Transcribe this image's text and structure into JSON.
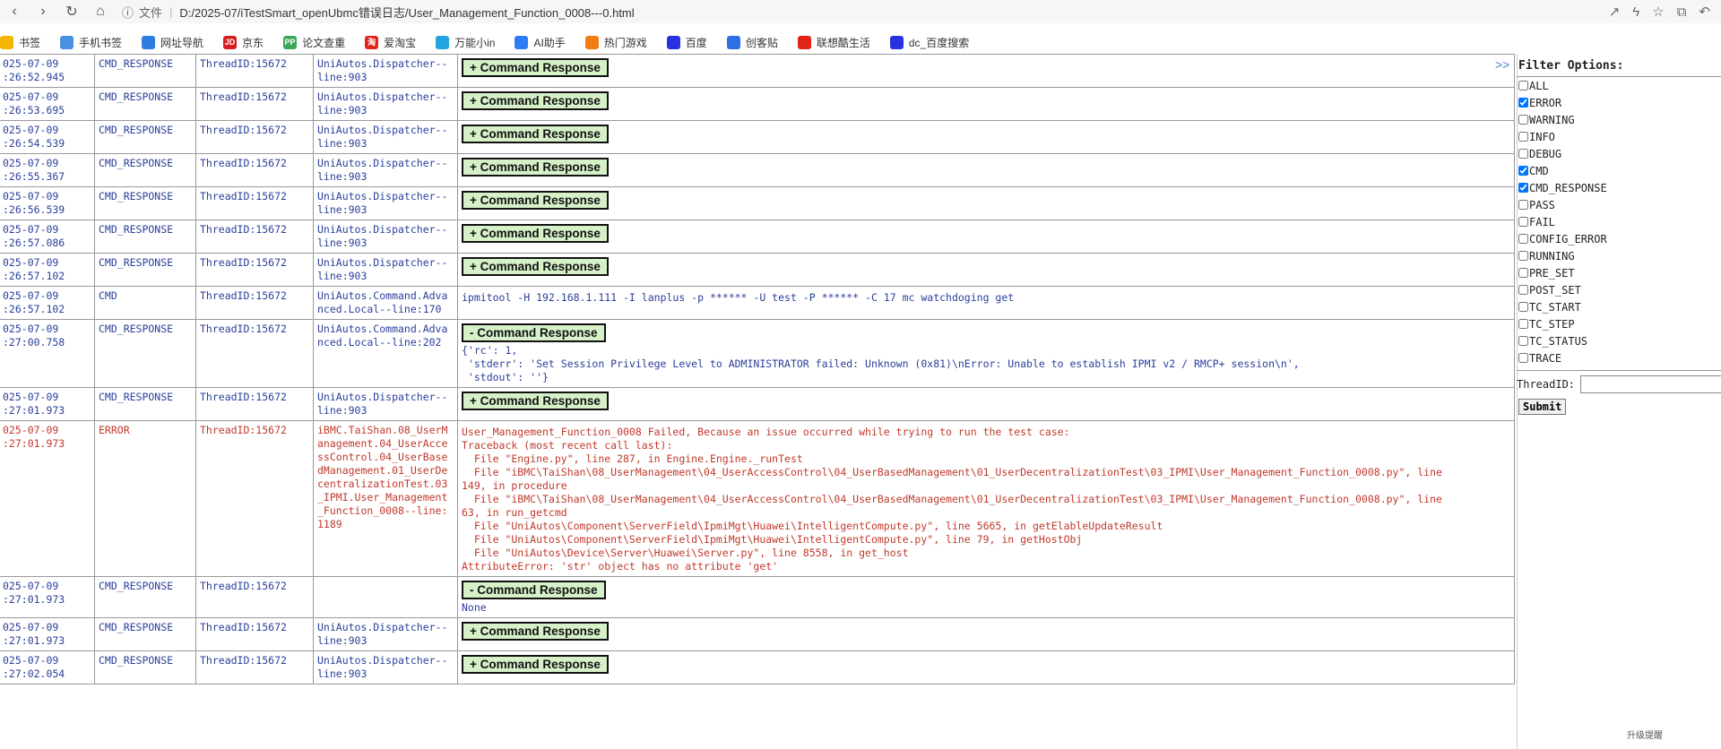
{
  "browser": {
    "file_label": "文件",
    "address": "D:/2025-07/iTestSmart_openUbmc错误日志/User_Management_Function_0008---0.html"
  },
  "bookmarks": [
    {
      "label": "书签",
      "icon": "star-icon",
      "color": "#f5b400"
    },
    {
      "label": "手机书签",
      "icon": "folder-icon",
      "color": "#4a90e2"
    },
    {
      "label": "网址导航",
      "icon": "nav-icon",
      "color": "#2e7de1"
    },
    {
      "label": "京东",
      "icon": "jd-icon",
      "color": "#d71c1e",
      "glyph": "JD"
    },
    {
      "label": "论文查重",
      "icon": "pp-icon",
      "color": "#3aa757",
      "glyph": "PP"
    },
    {
      "label": "爱淘宝",
      "icon": "taobao-icon",
      "color": "#e1251b",
      "glyph": "淘"
    },
    {
      "label": "万能小in",
      "icon": "in-icon",
      "color": "#21a4e0"
    },
    {
      "label": "AI助手",
      "icon": "ai-icon",
      "color": "#2f7df6"
    },
    {
      "label": "热门游戏",
      "icon": "game-icon",
      "color": "#f27b13"
    },
    {
      "label": "百度",
      "icon": "baidu-icon",
      "color": "#2932e1"
    },
    {
      "label": "创客贴",
      "icon": "ckt-icon",
      "color": "#2f6fe4"
    },
    {
      "label": "联想酷生活",
      "icon": "lenovo-icon",
      "color": "#e2231a"
    },
    {
      "label": "dc_百度搜索",
      "icon": "baidu-icon",
      "color": "#2932e1"
    }
  ],
  "log": {
    "response_plus": "+ Command Response",
    "response_minus": "- Command Response",
    "rows": [
      {
        "time": "025-07-09\n:26:52.945",
        "level": "CMD_RESPONSE",
        "thread": "ThreadID:15672",
        "source": "UniAutos.Dispatcher--line:903",
        "kind": "plus"
      },
      {
        "time": "025-07-09\n:26:53.695",
        "level": "CMD_RESPONSE",
        "thread": "ThreadID:15672",
        "source": "UniAutos.Dispatcher--line:903",
        "kind": "plus"
      },
      {
        "time": "025-07-09\n:26:54.539",
        "level": "CMD_RESPONSE",
        "thread": "ThreadID:15672",
        "source": "UniAutos.Dispatcher--line:903",
        "kind": "plus"
      },
      {
        "time": "025-07-09\n:26:55.367",
        "level": "CMD_RESPONSE",
        "thread": "ThreadID:15672",
        "source": "UniAutos.Dispatcher--line:903",
        "kind": "plus"
      },
      {
        "time": "025-07-09\n:26:56.539",
        "level": "CMD_RESPONSE",
        "thread": "ThreadID:15672",
        "source": "UniAutos.Dispatcher--line:903",
        "kind": "plus"
      },
      {
        "time": "025-07-09\n:26:57.086",
        "level": "CMD_RESPONSE",
        "thread": "ThreadID:15672",
        "source": "UniAutos.Dispatcher--line:903",
        "kind": "plus"
      },
      {
        "time": "025-07-09\n:26:57.102",
        "level": "CMD_RESPONSE",
        "thread": "ThreadID:15672",
        "source": "UniAutos.Dispatcher--line:903",
        "kind": "plus"
      },
      {
        "time": "025-07-09\n:26:57.102",
        "level": "CMD",
        "thread": "ThreadID:15672",
        "source": "UniAutos.Command.Advanced.Local--line:170",
        "kind": "text",
        "message": "ipmitool -H 192.168.1.111 -I lanplus -p ****** -U test -P ****** -C 17 mc watchdoging get"
      },
      {
        "time": "025-07-09\n:27:00.758",
        "level": "CMD_RESPONSE",
        "thread": "ThreadID:15672",
        "source": "UniAutos.Command.Advanced.Local--line:202",
        "kind": "minus",
        "detail": "{'rc': 1,\n 'stderr': 'Set Session Privilege Level to ADMINISTRATOR failed: Unknown (0x81)\\nError: Unable to establish IPMI v2 / RMCP+ session\\n',\n 'stdout': ''}"
      },
      {
        "time": "025-07-09\n:27:01.973",
        "level": "CMD_RESPONSE",
        "thread": "ThreadID:15672",
        "source": "UniAutos.Dispatcher--line:903",
        "kind": "plus"
      },
      {
        "time": "025-07-09\n:27:01.973",
        "level": "ERROR",
        "thread": "ThreadID:15672",
        "source": "iBMC.TaiShan.08_UserManagement.04_UserAccessControl.04_UserBasedManagement.01_UserDecentralizationTest.03_IPMI.User_Management_Function_0008--line:1189",
        "kind": "text",
        "message": "User_Management_Function_0008 Failed, Because an issue occurred while trying to run the test case:\nTraceback (most recent call last):\n  File \"Engine.py\", line 287, in Engine.Engine._runTest\n  File \"iBMC\\TaiShan\\08_UserManagement\\04_UserAccessControl\\04_UserBasedManagement\\01_UserDecentralizationTest\\03_IPMI\\User_Management_Function_0008.py\", line\n149, in procedure\n  File \"iBMC\\TaiShan\\08_UserManagement\\04_UserAccessControl\\04_UserBasedManagement\\01_UserDecentralizationTest\\03_IPMI\\User_Management_Function_0008.py\", line\n63, in run_getcmd\n  File \"UniAutos\\Component\\ServerField\\IpmiMgt\\Huawei\\IntelligentCompute.py\", line 5665, in getElableUpdateResult\n  File \"UniAutos\\Component\\ServerField\\IpmiMgt\\Huawei\\IntelligentCompute.py\", line 79, in getHostObj\n  File \"UniAutos\\Device\\Server\\Huawei\\Server.py\", line 8558, in get_host\nAttributeError: 'str' object has no attribute 'get'"
      },
      {
        "time": "025-07-09\n:27:01.973",
        "level": "CMD_RESPONSE",
        "thread": "ThreadID:15672",
        "source": "",
        "kind": "minus",
        "detail": "None"
      },
      {
        "time": "025-07-09\n:27:01.973",
        "level": "CMD_RESPONSE",
        "thread": "ThreadID:15672",
        "source": "UniAutos.Dispatcher--line:903",
        "kind": "plus"
      },
      {
        "time": "025-07-09\n:27:02.054",
        "level": "CMD_RESPONSE",
        "thread": "ThreadID:15672",
        "source": "UniAutos.Dispatcher--line:903",
        "kind": "plus"
      }
    ]
  },
  "filter": {
    "title": "Filter Options:",
    "options": [
      {
        "label": "ALL",
        "checked": false
      },
      {
        "label": "ERROR",
        "checked": true
      },
      {
        "label": "WARNING",
        "checked": false
      },
      {
        "label": "INFO",
        "checked": false
      },
      {
        "label": "DEBUG",
        "checked": false
      },
      {
        "label": "CMD",
        "checked": true
      },
      {
        "label": "CMD_RESPONSE",
        "checked": true
      },
      {
        "label": "PASS",
        "checked": false
      },
      {
        "label": "FAIL",
        "checked": false
      },
      {
        "label": "CONFIG_ERROR",
        "checked": false
      },
      {
        "label": "RUNNING",
        "checked": false
      },
      {
        "label": "PRE_SET",
        "checked": false
      },
      {
        "label": "POST_SET",
        "checked": false
      },
      {
        "label": "TC_START",
        "checked": false
      },
      {
        "label": "TC_STEP",
        "checked": false
      },
      {
        "label": "TC_STATUS",
        "checked": false
      },
      {
        "label": "TRACE",
        "checked": false
      }
    ],
    "thread_label": "ThreadID:",
    "thread_value": "",
    "submit_label": "Submit"
  },
  "footer": {
    "upgrade_text": "升级提醒"
  }
}
